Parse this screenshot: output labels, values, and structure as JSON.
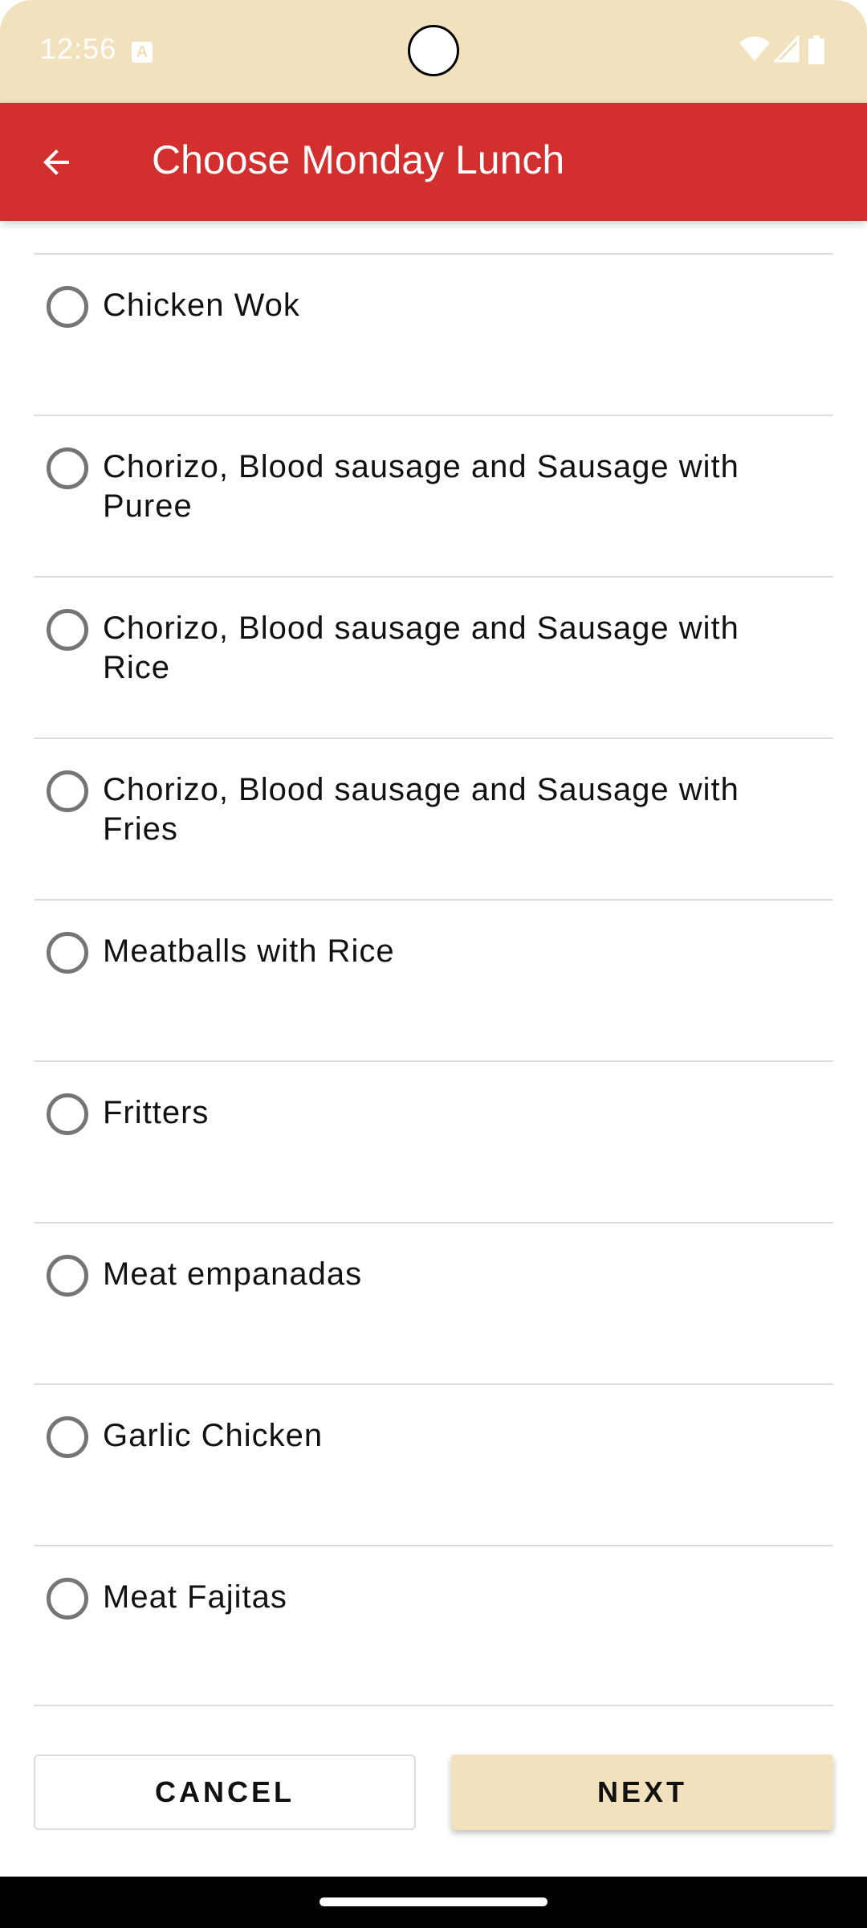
{
  "status_bar": {
    "time": "12:56",
    "notification_icon": "a-box-icon",
    "icons": [
      "wifi-icon",
      "signal-icon",
      "battery-icon"
    ]
  },
  "app_bar": {
    "title": "Choose Monday Lunch",
    "back_icon": "arrow-left-icon",
    "color": "#d32f2f"
  },
  "options": [
    {
      "label": "Chicken Wok",
      "selected": false
    },
    {
      "label": "Chorizo, Blood sausage and Sausage with Puree",
      "selected": false
    },
    {
      "label": "Chorizo, Blood sausage and Sausage with Rice",
      "selected": false
    },
    {
      "label": "Chorizo, Blood sausage and Sausage with Fries",
      "selected": false
    },
    {
      "label": "Meatballs with Rice",
      "selected": false
    },
    {
      "label": "Fritters",
      "selected": false
    },
    {
      "label": "Meat empanadas",
      "selected": false
    },
    {
      "label": "Garlic Chicken",
      "selected": false
    },
    {
      "label": "Meat Fajitas",
      "selected": false
    }
  ],
  "actions": {
    "cancel_label": "CANCEL",
    "next_label": "NEXT",
    "next_color": "#f2e1bd"
  }
}
